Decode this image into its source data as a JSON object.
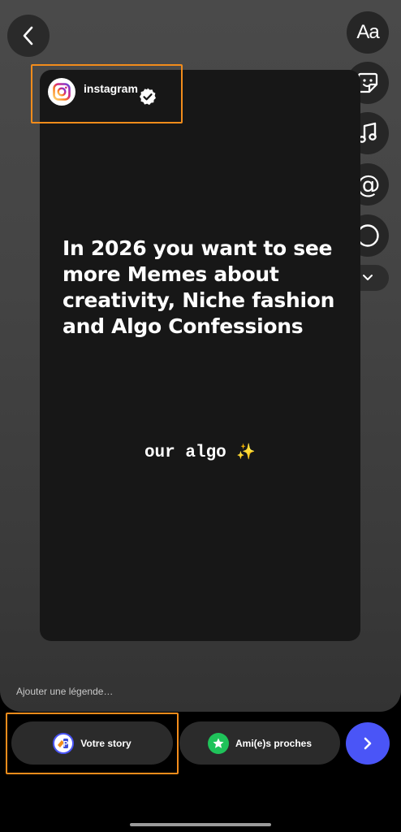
{
  "toolbar": {
    "text_tool_label": "Aa",
    "mention_label": "@",
    "tools": [
      "text-icon",
      "sticker-icon",
      "music-icon",
      "mention-icon",
      "circle-icon",
      "chevron-down-icon"
    ]
  },
  "story": {
    "account_name": "instagram",
    "verified": true,
    "headline": "In 2026 you want to see more Memes about creativity, Niche fashion and Algo Confessions",
    "subline_text": "our algo ",
    "subline_emoji": "✨"
  },
  "caption": {
    "placeholder": "Ajouter une légende…"
  },
  "share": {
    "your_story_label": "Votre story",
    "close_friends_label": "Ami(e)s proches"
  },
  "colors": {
    "highlight": "#f28c1b",
    "send_button": "#4a55f7",
    "close_friends_green": "#1fc35a"
  }
}
